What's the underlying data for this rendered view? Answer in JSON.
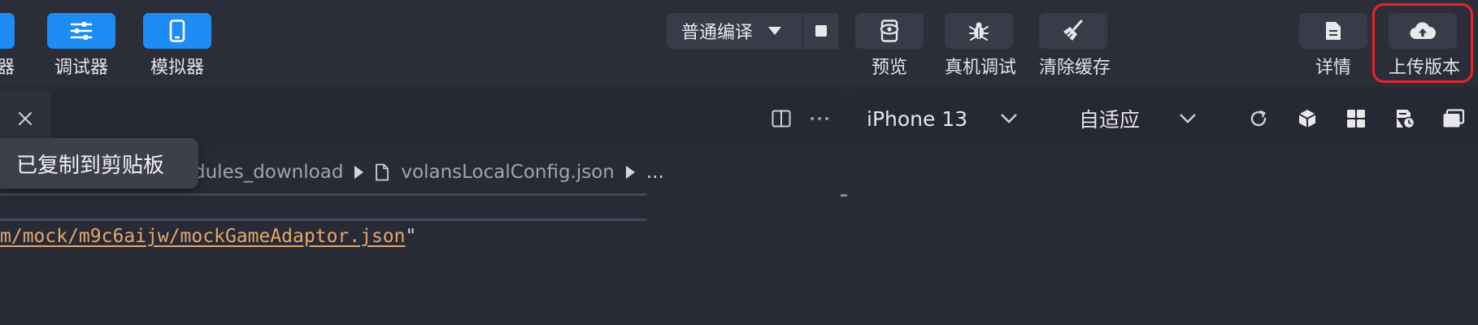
{
  "toolbar": {
    "left_buttons": [
      {
        "label": "器",
        "icon": "editor-icon"
      },
      {
        "label": "调试器",
        "icon": "sliders-icon"
      },
      {
        "label": "模拟器",
        "icon": "phone-icon"
      }
    ],
    "compile_mode": "普通编译",
    "actions": [
      {
        "label": "预览",
        "icon": "eye-phone-icon"
      },
      {
        "label": "真机调试",
        "icon": "bug-icon"
      },
      {
        "label": "清除缓存",
        "icon": "broom-icon"
      }
    ],
    "right_actions": [
      {
        "label": "详情",
        "icon": "document-icon"
      },
      {
        "label": "上传版本",
        "icon": "cloud-upload-icon"
      }
    ],
    "colors": {
      "accent": "#1e8cf5",
      "highlight": "#e8242a"
    }
  },
  "simulator": {
    "device": "iPhone 13",
    "scale": "自适应"
  },
  "editor": {
    "toast": "已复制到剪贴板",
    "breadcrumb": [
      "dules_download",
      "volansLocalConfig.json",
      "..."
    ],
    "code_text": "m/mock/m9c6aijw/mockGameAdaptor.json",
    "code_quote": "\""
  }
}
